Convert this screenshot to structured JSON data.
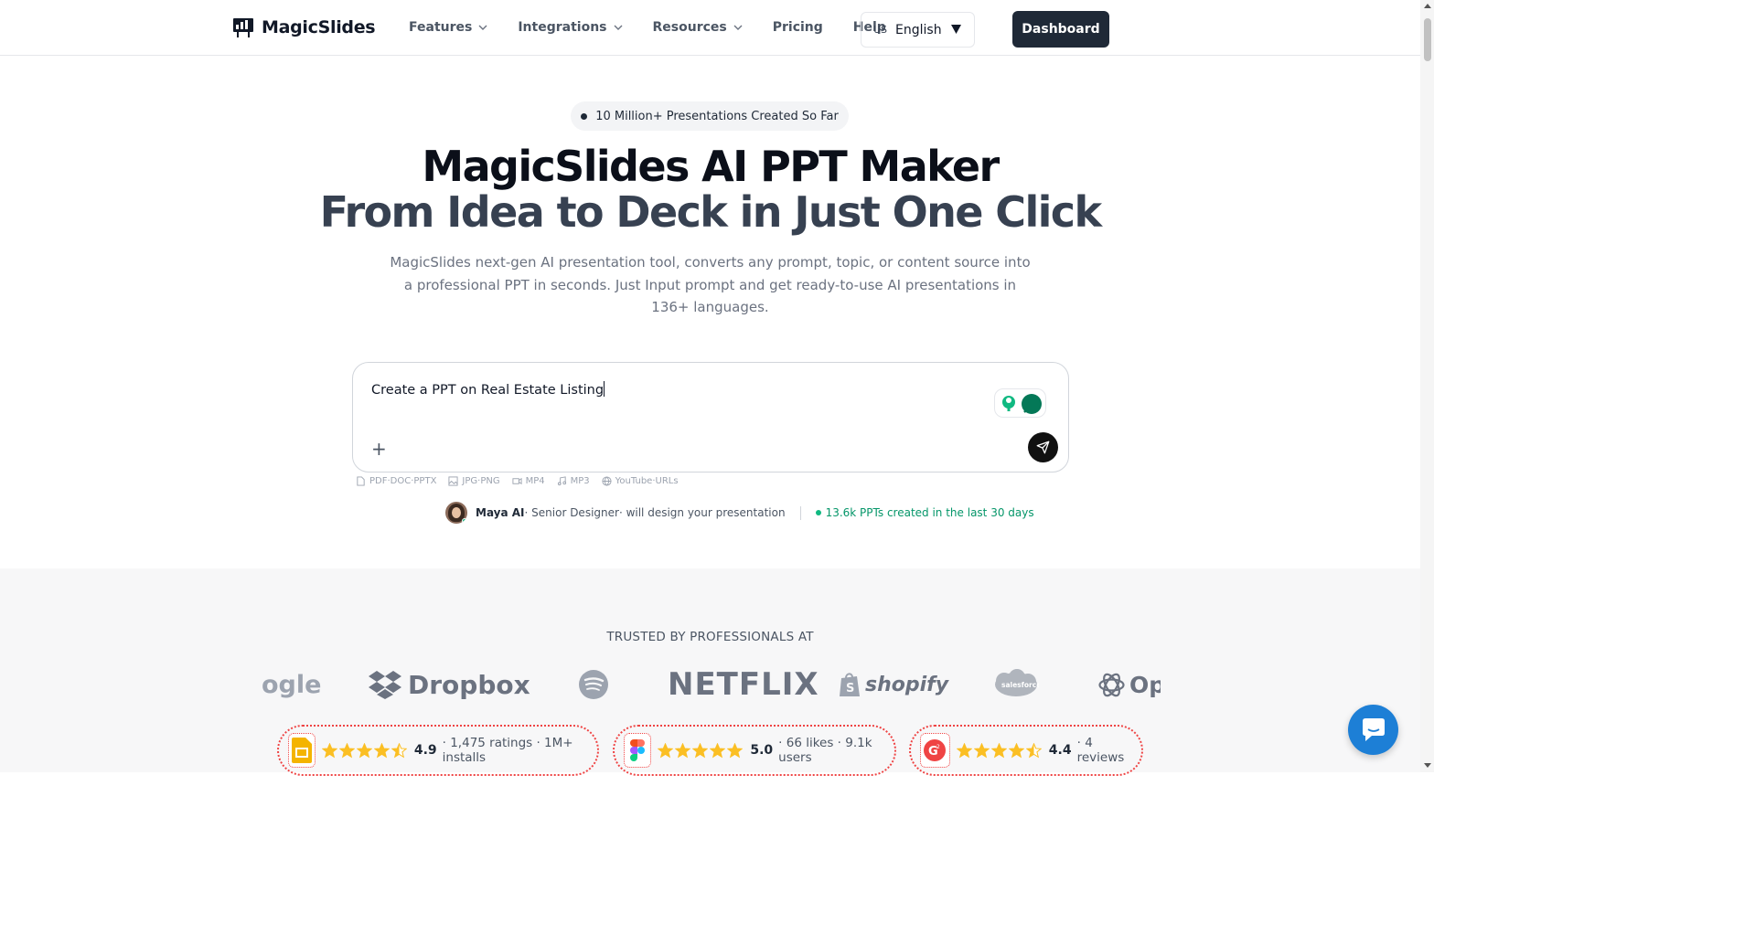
{
  "brand": {
    "name": "MagicSlides"
  },
  "nav": {
    "items": [
      {
        "label": "Features"
      },
      {
        "label": "Integrations"
      },
      {
        "label": "Resources"
      },
      {
        "label": "Pricing"
      },
      {
        "label": "Help"
      }
    ],
    "language": {
      "flag": "US",
      "label": "English"
    },
    "dashboard_label": "Dashboard"
  },
  "hero": {
    "pill": "10 Million+ Presentations Created So Far",
    "title_line1": "MagicSlides AI PPT Maker",
    "title_line2": "From Idea to Deck in Just One Click",
    "subtitle": "MagicSlides next-gen AI presentation tool, converts any prompt, topic, or content source into a professional PPT in seconds. Just Input prompt and get ready-to-use AI presentations in 136+ languages."
  },
  "prompt": {
    "value": "Create a PPT on Real Estate Listing",
    "plus": "+",
    "formats": [
      {
        "icon": "document-icon",
        "label": "PDF·DOC·PPTX"
      },
      {
        "icon": "image-icon",
        "label": "JPG·PNG"
      },
      {
        "icon": "video-icon",
        "label": "MP4"
      },
      {
        "icon": "music-icon",
        "label": "MP3"
      },
      {
        "icon": "globe-icon",
        "label": "YouTube·URLs"
      }
    ]
  },
  "designer": {
    "name": "Maya AI",
    "role": " · Senior Designer",
    "tagline": " · will design your presentation",
    "stat": "13.6k PPTs created in the last 30 days"
  },
  "trusted": {
    "title": "TRUSTED BY PROFESSIONALS AT",
    "logos": [
      "ogle",
      "Dropbox",
      "Spotify",
      "NETFLIX",
      "shopify",
      "salesforce",
      "Op"
    ]
  },
  "ratings": [
    {
      "app": "google-slides-icon",
      "stars": 4.5,
      "score": "4.9",
      "meta": "· 1,475 ratings · 1M+ installs"
    },
    {
      "app": "figma-icon",
      "stars": 5,
      "score": "5.0",
      "meta": "· 66 likes · 9.1k users"
    },
    {
      "app": "g2-icon",
      "stars": 4.5,
      "score": "4.4",
      "meta": "· 4 reviews"
    }
  ],
  "colors": {
    "primary_dark": "#1f2937",
    "accent_green": "#10b981",
    "star": "#fbbf24",
    "rating_border": "#ef4444",
    "chat": "#1d7fd6"
  }
}
